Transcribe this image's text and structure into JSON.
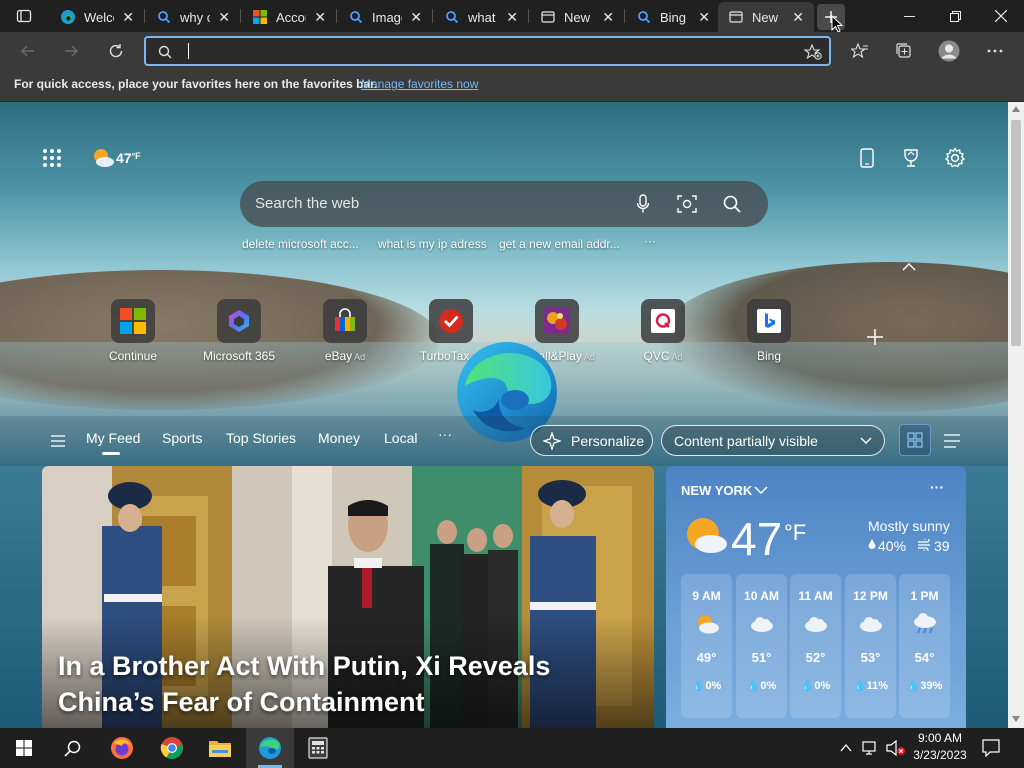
{
  "tabs": [
    {
      "title": "Welcome",
      "icon": "edge-icon"
    },
    {
      "title": "why c",
      "icon": "bing-search-icon"
    },
    {
      "title": "Account",
      "icon": "microsoft-icon"
    },
    {
      "title": "Images",
      "icon": "bing-search-icon"
    },
    {
      "title": "what",
      "icon": "bing-search-icon"
    },
    {
      "title": "New",
      "icon": "newtab-icon"
    },
    {
      "title": "Bing",
      "icon": "bing-search-icon"
    },
    {
      "title": "New",
      "icon": "newtab-icon",
      "active": true
    }
  ],
  "address_bar": {
    "value": "",
    "placeholder": ""
  },
  "favorites_bar": {
    "message": "For quick access, place your favorites here on the favorites bar.",
    "link": "Manage favorites now"
  },
  "newtab": {
    "weather_mini": "47",
    "weather_mini_unit": "°F",
    "search_placeholder": "Search the web",
    "suggestions": [
      "delete microsoft acc...",
      "what is my ip adress",
      "get a new email addr..."
    ],
    "more_suggestions": "···",
    "quick_links": [
      {
        "label": "Continue",
        "ad": ""
      },
      {
        "label": "Microsoft 365",
        "ad": ""
      },
      {
        "label": "eBay",
        "ad": "Ad"
      },
      {
        "label": "TurboTax",
        "ad": "Ad"
      },
      {
        "label": "Install&Play",
        "ad": "Ad"
      },
      {
        "label": "QVC",
        "ad": "Ad"
      },
      {
        "label": "Bing",
        "ad": ""
      }
    ]
  },
  "feed": {
    "tabs": [
      "My Feed",
      "Sports",
      "Top Stories",
      "Money",
      "Local"
    ],
    "more": "···",
    "personalize": "Personalize",
    "content_visibility": "Content partially visible"
  },
  "news": {
    "headline": "In a Brother Act With Putin, Xi Reveals China’s Fear of Containment"
  },
  "weather": {
    "city": "NEW YORK",
    "temp": "47",
    "unit": "°F",
    "condition": "Mostly sunny",
    "precip": "40%",
    "wind": "39",
    "more": "···",
    "hours": [
      {
        "time": "9 AM",
        "temp": "49°",
        "precip": "0%",
        "icon": "partly-sunny-icon"
      },
      {
        "time": "10 AM",
        "temp": "51°",
        "precip": "0%",
        "icon": "cloud-icon"
      },
      {
        "time": "11 AM",
        "temp": "52°",
        "precip": "0%",
        "icon": "cloud-icon"
      },
      {
        "time": "12 PM",
        "temp": "53°",
        "precip": "11%",
        "icon": "cloud-icon"
      },
      {
        "time": "1 PM",
        "temp": "54°",
        "precip": "39%",
        "icon": "rain-cloud-icon"
      }
    ]
  },
  "taskbar": {
    "time": "9:00 AM",
    "date": "3/23/2023"
  },
  "colors": {
    "accent_blue": "#7ab8f5",
    "tabbar_bg": "#202020",
    "toolbar_bg": "#3a3a3a",
    "weather_card": "#5a8fd0"
  }
}
